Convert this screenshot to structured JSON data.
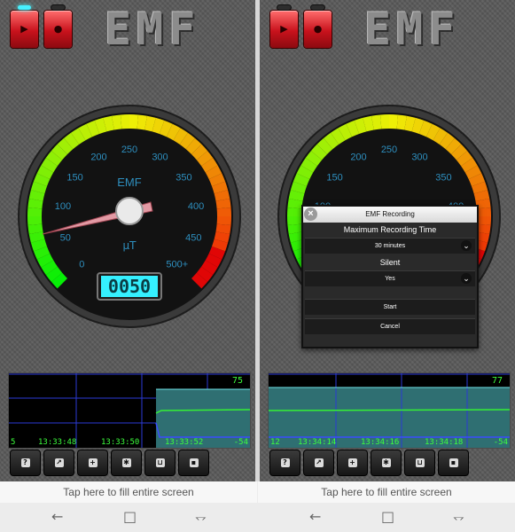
{
  "app_logo": "EMF",
  "gauge": {
    "title": "EMF",
    "unit": "μT",
    "ticks": [
      "0",
      "50",
      "100",
      "150",
      "200",
      "250",
      "300",
      "350",
      "400",
      "450",
      "500+"
    ],
    "display_value": "0050"
  },
  "graph": {
    "left_panel": {
      "max_label": "75",
      "min_label": "-54",
      "start_label": "5",
      "times": [
        "13:33:48",
        "13:33:50",
        "13:33:52"
      ]
    },
    "right_panel": {
      "max_label": "77",
      "min_label": "-54",
      "start_label": "12",
      "times": [
        "13:34:14",
        "13:34:16",
        "13:34:18"
      ]
    }
  },
  "toolbar_icons": [
    "help-icon",
    "chart-icon",
    "add-icon",
    "settings-icon",
    "cart-icon",
    "save-icon"
  ],
  "dialog": {
    "title": "EMF Recording",
    "max_time_label": "Maximum Recording Time",
    "max_time_value": "30 minutes",
    "silent_label": "Silent",
    "silent_value": "Yes",
    "start_label": "Start",
    "cancel_label": "Cancel"
  },
  "tap_bar": "Tap here to fill entire screen",
  "colors": {
    "accent_red": "#c8121c",
    "lcd": "#35f0ff",
    "graph_green": "#3dff3d"
  }
}
